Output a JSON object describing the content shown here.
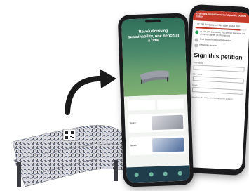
{
  "colors": {
    "brand_green": "#2f6f5a",
    "petition_red": "#c23b2b",
    "nav_bg": "#1f3d4a",
    "arrow": "#1a1a1a"
  },
  "front_phone": {
    "hero_title": "Revolutionising sustainability, one bench at a time",
    "products": [
      {
        "label": "Bench"
      },
      {
        "label": "Bench"
      }
    ]
  },
  "back_phone": {
    "header": "Change Legislation around plastic bottles today",
    "count_text": "177,156 have signed. Let's get to 200,000",
    "progress": 0.88,
    "checks": [
      "At 100,000 signatures, this petition becomes one of the top signed on Change.org",
      "Brad Marsden started this petition",
      "Response received"
    ],
    "sign_title": "Sign this petition",
    "fields": [
      "First name",
      "Last name",
      "Email"
    ],
    "footer": "Would you like to stay informed about this petition?"
  },
  "icons": [
    "arrow-icon",
    "bench-icon",
    "qr-code-icon"
  ]
}
